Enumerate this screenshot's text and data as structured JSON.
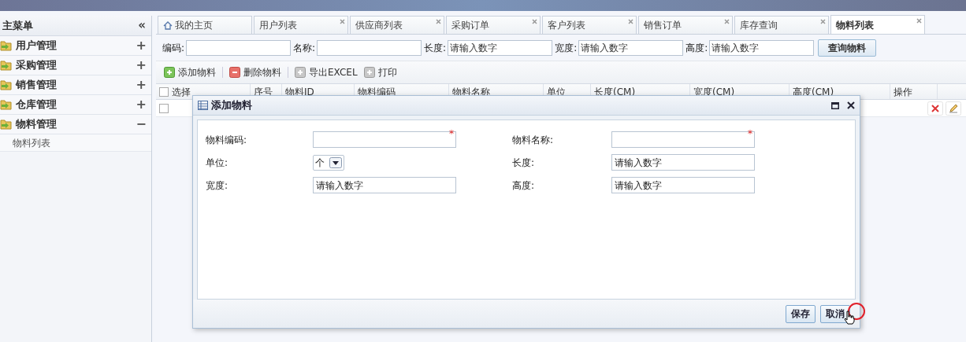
{
  "sidebar": {
    "title": "主菜单",
    "collapse": "«",
    "items": [
      {
        "label": "用户管理",
        "toggle": "+"
      },
      {
        "label": "采购管理",
        "toggle": "+"
      },
      {
        "label": "销售管理",
        "toggle": "+"
      },
      {
        "label": "仓库管理",
        "toggle": "+"
      },
      {
        "label": "物料管理",
        "toggle": "−",
        "children": [
          {
            "label": "物料列表"
          }
        ]
      }
    ]
  },
  "tabs": [
    {
      "label": "我的主页",
      "selected": false,
      "kind": "home"
    },
    {
      "label": "用户列表",
      "selected": false,
      "kind": "closable"
    },
    {
      "label": "供应商列表",
      "selected": false,
      "kind": "closable"
    },
    {
      "label": "采购订单",
      "selected": false,
      "kind": "closable"
    },
    {
      "label": "客户列表",
      "selected": false,
      "kind": "closable"
    },
    {
      "label": "销售订单",
      "selected": false,
      "kind": "closable"
    },
    {
      "label": "库存查询",
      "selected": false,
      "kind": "closable"
    },
    {
      "label": "物料列表",
      "selected": true,
      "kind": "closable"
    }
  ],
  "search": {
    "fields": [
      {
        "label": "编码:"
      },
      {
        "label": "名称:"
      },
      {
        "label": "长度:",
        "placeholder": "请输入数字"
      },
      {
        "label": "宽度:",
        "placeholder": "请输入数字"
      },
      {
        "label": "高度:",
        "placeholder": "请输入数字"
      }
    ],
    "button": "查询物料"
  },
  "toolbar": [
    {
      "label": "添加物料",
      "kind": "add"
    },
    {
      "label": "删除物料",
      "kind": "delete"
    },
    {
      "label": "导出EXCEL",
      "kind": "plain"
    },
    {
      "label": "打印",
      "kind": "plain"
    }
  ],
  "table": {
    "select_all_checked": false,
    "columns": [
      "选择",
      "序号",
      "物料ID",
      "物料编码",
      "物料名称",
      "单位",
      "长度(CM)",
      "宽度(CM)",
      "高度(CM)",
      "操作"
    ],
    "rows": [
      {
        "checked": false
      }
    ]
  },
  "dialog": {
    "title": "添加物料",
    "fields": [
      {
        "label": "物料编码:",
        "kind": "text",
        "required_mark": "*"
      },
      {
        "label": "物料名称:",
        "kind": "text",
        "required_mark": "*"
      },
      {
        "label": "单位:",
        "kind": "select",
        "value": "个"
      },
      {
        "label": "长度:",
        "kind": "text",
        "placeholder": "请输入数字"
      },
      {
        "label": "宽度:",
        "kind": "text",
        "placeholder": "请输入数字"
      },
      {
        "label": "高度:",
        "kind": "text",
        "placeholder": "请输入数字"
      }
    ],
    "buttons": [
      "保存",
      "取消"
    ]
  }
}
